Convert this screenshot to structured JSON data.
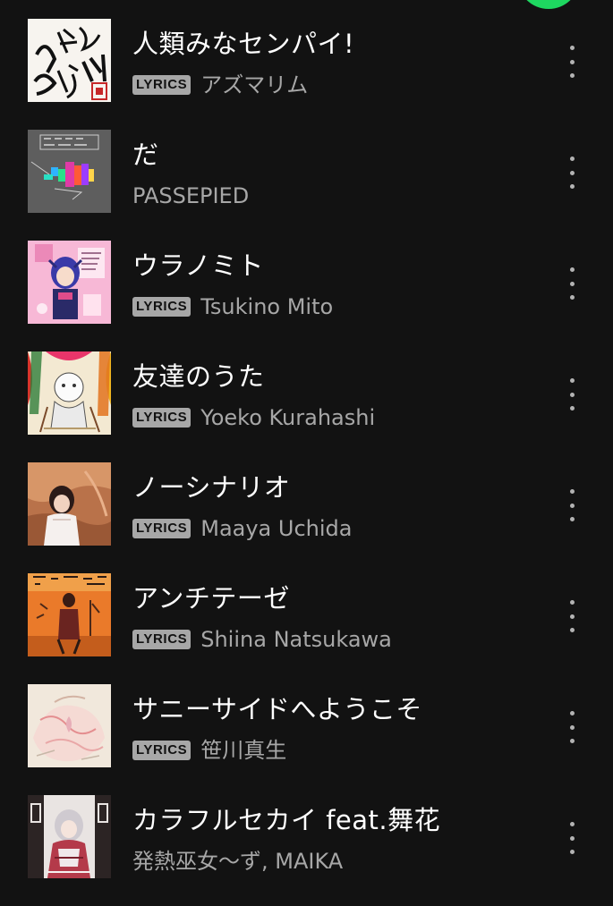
{
  "colors": {
    "background": "#121212",
    "accent": "#1ed760",
    "title_text": "#ffffff",
    "secondary_text": "#a7a7a7",
    "badge_bg": "#a7a7a7"
  },
  "tracks": [
    {
      "title": "人類みなセンパイ!",
      "lyrics_badge": "LYRICS",
      "artist": "アズマリム",
      "menu_icon": "more-vertical-icon"
    },
    {
      "title": "だ",
      "lyrics_badge": null,
      "artist": "PASSEPIED",
      "menu_icon": "more-vertical-icon"
    },
    {
      "title": "ウラノミト",
      "lyrics_badge": "LYRICS",
      "artist": "Tsukino Mito",
      "menu_icon": "more-vertical-icon"
    },
    {
      "title": "友達のうた",
      "lyrics_badge": "LYRICS",
      "artist": "Yoeko Kurahashi",
      "menu_icon": "more-vertical-icon"
    },
    {
      "title": "ノーシナリオ",
      "lyrics_badge": "LYRICS",
      "artist": "Maaya Uchida",
      "menu_icon": "more-vertical-icon"
    },
    {
      "title": "アンチテーゼ",
      "lyrics_badge": "LYRICS",
      "artist": "Shiina Natsukawa",
      "menu_icon": "more-vertical-icon"
    },
    {
      "title": "サニーサイドへようこそ",
      "lyrics_badge": "LYRICS",
      "artist": "笹川真生",
      "menu_icon": "more-vertical-icon"
    },
    {
      "title": "カラフルセカイ feat.舞花",
      "lyrics_badge": null,
      "artist": "発熱巫女〜ず, MAIKA",
      "menu_icon": "more-vertical-icon"
    }
  ]
}
